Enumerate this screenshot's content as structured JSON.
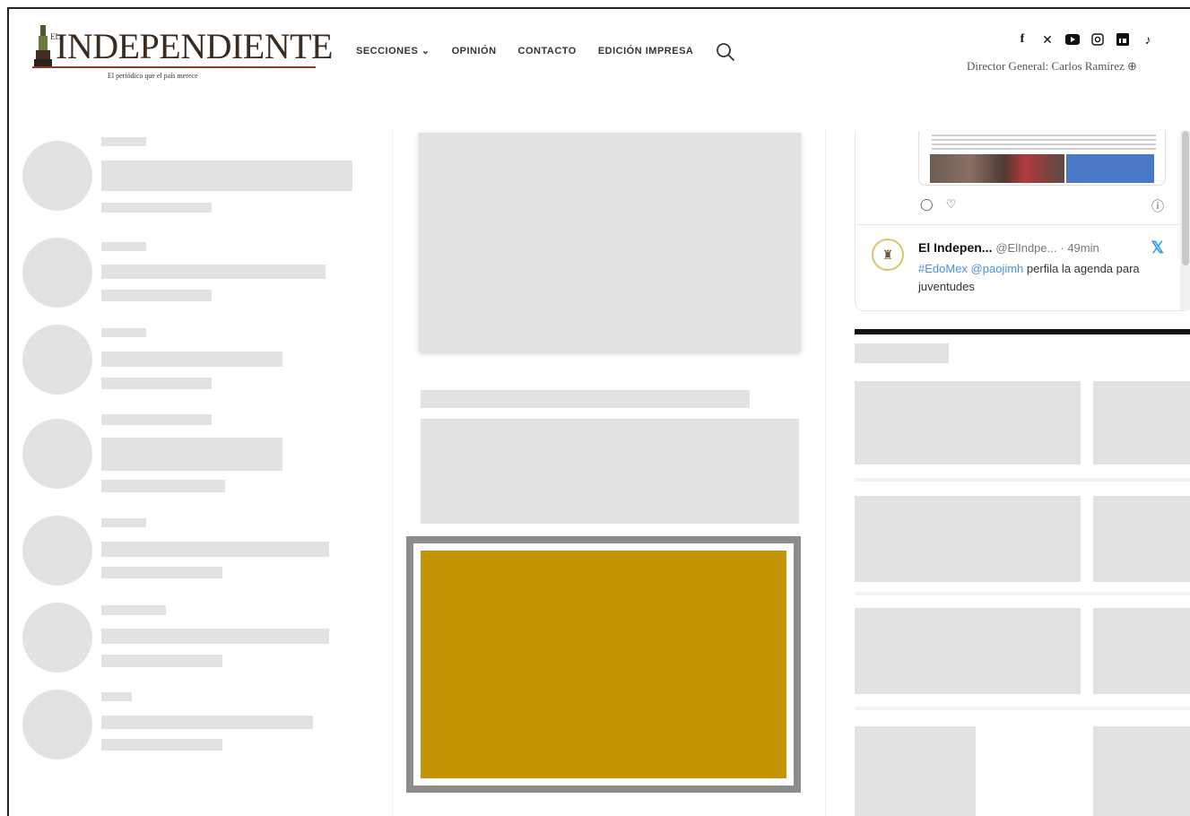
{
  "brand": {
    "logo_prefix": "EL",
    "logo_word": "INDEPENDIENTE",
    "tagline": "El periódico que el país merece"
  },
  "nav": {
    "items": [
      {
        "label": "SECCIONES ⌄"
      },
      {
        "label": "OPINIÓN"
      },
      {
        "label": "CONTACTO"
      },
      {
        "label": "EDICIÓN IMPRESA"
      }
    ]
  },
  "header": {
    "social_icons": [
      "facebook-icon",
      "x-icon",
      "youtube-icon",
      "instagram-icon",
      "linkedin-icon",
      "tiktok-icon"
    ],
    "director": "Director General: Carlos Ramírez ⊕"
  },
  "tweet": {
    "name": "El Indepen...",
    "handle": "@ElIndpe...",
    "time": "· 49min",
    "hashtag": "#EdoMex",
    "mention": "@paojimh",
    "text": "perfila la agenda para juventudes"
  },
  "colors": {
    "ad_fill": "#c39404",
    "skeleton": "#e2e2e2",
    "twitter_blue": "#1d9bf0"
  }
}
